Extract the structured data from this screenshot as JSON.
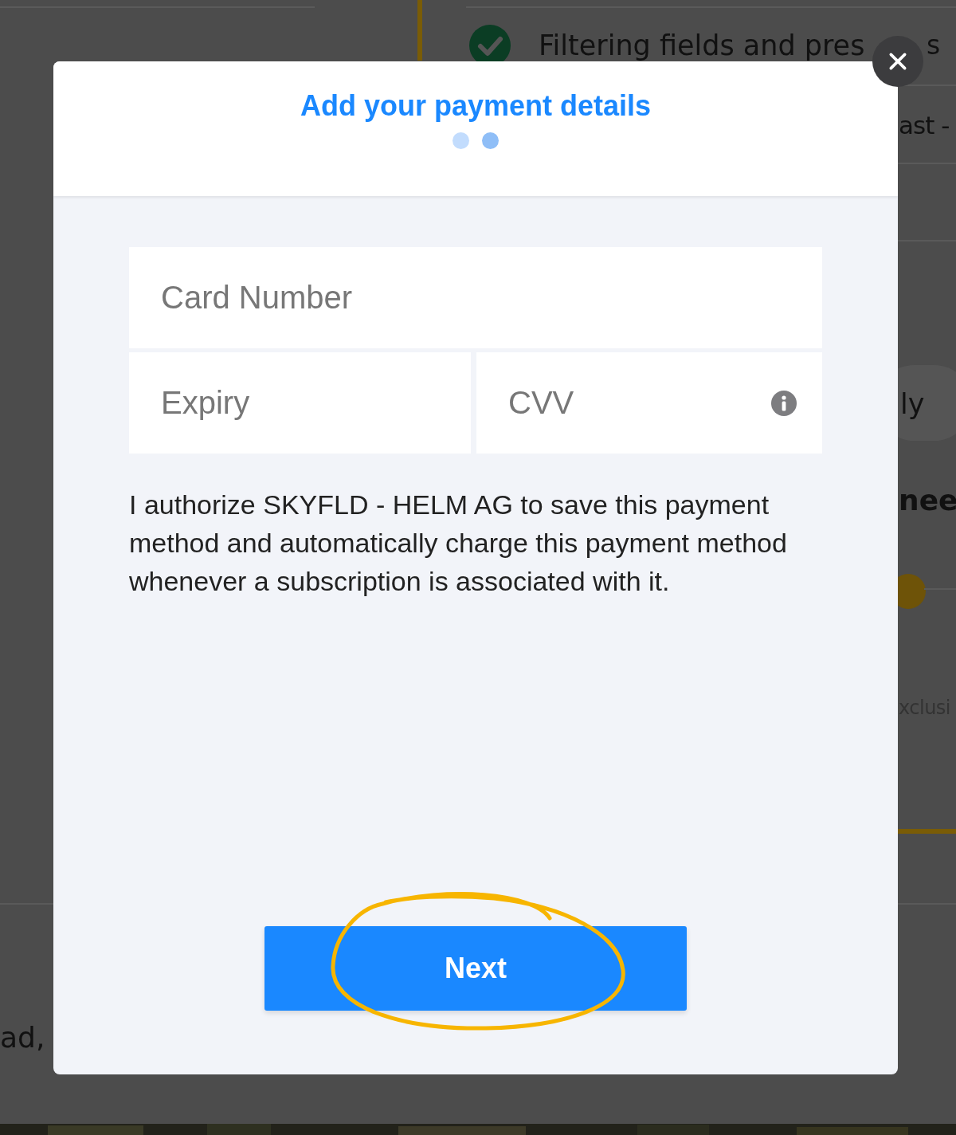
{
  "background": {
    "checklist_item": {
      "checked": true,
      "text": "Filtering fields and pres",
      "text_tail": "s"
    },
    "fragment_text": "ast -",
    "pill_text": "ly",
    "heading_fragment": "nee",
    "muted_fragment": "xclusi",
    "bottom_fragment": "ad,"
  },
  "modal": {
    "title": "Add your payment details",
    "steps": [
      {
        "selected": false
      },
      {
        "selected": true
      }
    ],
    "card_number": {
      "placeholder": "Card Number"
    },
    "expiry": {
      "placeholder": "Expiry"
    },
    "cvv": {
      "placeholder": "CVV"
    },
    "consent_text": "I authorize SKYFLD - HELM AG to save this payment method and automatically charge this payment method whenever a subscription is associated with it.",
    "next_button": "Next"
  }
}
